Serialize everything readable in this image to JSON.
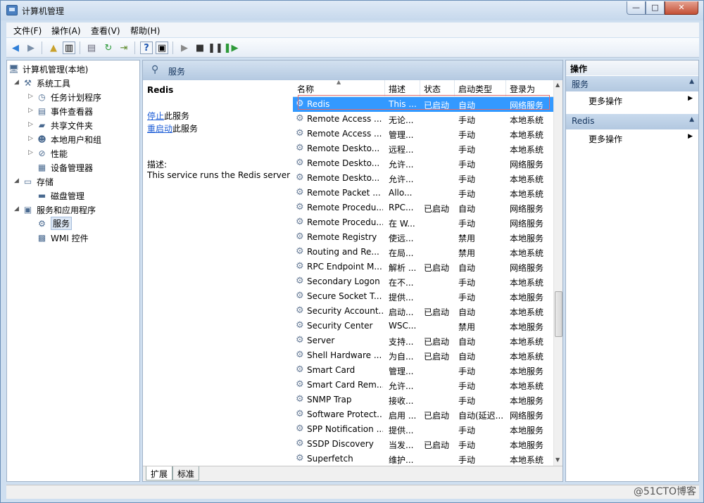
{
  "window": {
    "title": "计算机管理",
    "min": "—",
    "max": "□",
    "close": "✕"
  },
  "menubar": [
    {
      "label": "文件(F)"
    },
    {
      "label": "操作(A)"
    },
    {
      "label": "查看(V)"
    },
    {
      "label": "帮助(H)"
    }
  ],
  "tree": [
    {
      "label": "计算机管理(本地)",
      "icon": "computer-icon",
      "glyph": "🖥",
      "expand": "",
      "indent": 0
    },
    {
      "label": "系统工具",
      "icon": "tools-icon",
      "glyph": "⚒",
      "expand": "◢",
      "indent": 1
    },
    {
      "label": "任务计划程序",
      "icon": "clock-icon",
      "glyph": "◷",
      "expand": "▷",
      "indent": 2
    },
    {
      "label": "事件查看器",
      "icon": "event-viewer-icon",
      "glyph": "▤",
      "expand": "▷",
      "indent": 2
    },
    {
      "label": "共享文件夹",
      "icon": "shared-folder-icon",
      "glyph": "▰",
      "expand": "▷",
      "indent": 2
    },
    {
      "label": "本地用户和组",
      "icon": "users-icon",
      "glyph": "☻",
      "expand": "▷",
      "indent": 2
    },
    {
      "label": "性能",
      "icon": "performance-icon",
      "glyph": "⊘",
      "expand": "▷",
      "indent": 2
    },
    {
      "label": "设备管理器",
      "icon": "device-manager-icon",
      "glyph": "▦",
      "expand": "",
      "indent": 2
    },
    {
      "label": "存储",
      "icon": "storage-icon",
      "glyph": "▭",
      "expand": "◢",
      "indent": 1
    },
    {
      "label": "磁盘管理",
      "icon": "disk-icon",
      "glyph": "▬",
      "expand": "",
      "indent": 2
    },
    {
      "label": "服务和应用程序",
      "icon": "services-apps-icon",
      "glyph": "▣",
      "expand": "◢",
      "indent": 1
    },
    {
      "label": "服务",
      "icon": "gear-icon",
      "glyph": "⚙",
      "expand": "",
      "indent": 2,
      "selected": true
    },
    {
      "label": "WMI 控件",
      "icon": "wmi-icon",
      "glyph": "▩",
      "expand": "",
      "indent": 2
    }
  ],
  "center": {
    "title": "服务",
    "description": {
      "service_name": "Redis",
      "stop_link": "停止",
      "stop_suffix": "此服务",
      "restart_link": "重启动",
      "restart_suffix": "此服务",
      "desc_label": "描述:",
      "desc_text": "This service runs the Redis server"
    },
    "columns": [
      "名称",
      "描述",
      "状态",
      "启动类型",
      "登录为"
    ],
    "services": [
      {
        "name": "Redis",
        "desc": "This ...",
        "status": "已启动",
        "startup": "自动",
        "logon": "网络服务"
      },
      {
        "name": "Remote Access ...",
        "desc": "无论...",
        "status": "",
        "startup": "手动",
        "logon": "本地系统"
      },
      {
        "name": "Remote Access ...",
        "desc": "管理...",
        "status": "",
        "startup": "手动",
        "logon": "本地系统"
      },
      {
        "name": "Remote Deskto...",
        "desc": "远程...",
        "status": "",
        "startup": "手动",
        "logon": "本地系统"
      },
      {
        "name": "Remote Deskto...",
        "desc": "允许...",
        "status": "",
        "startup": "手动",
        "logon": "网络服务"
      },
      {
        "name": "Remote Deskto...",
        "desc": "允许...",
        "status": "",
        "startup": "手动",
        "logon": "本地系统"
      },
      {
        "name": "Remote Packet ...",
        "desc": "Allo...",
        "status": "",
        "startup": "手动",
        "logon": "本地系统"
      },
      {
        "name": "Remote Procedu...",
        "desc": "RPC...",
        "status": "已启动",
        "startup": "自动",
        "logon": "网络服务"
      },
      {
        "name": "Remote Procedu...",
        "desc": "在 W...",
        "status": "",
        "startup": "手动",
        "logon": "网络服务"
      },
      {
        "name": "Remote Registry",
        "desc": "使远...",
        "status": "",
        "startup": "禁用",
        "logon": "本地服务"
      },
      {
        "name": "Routing and Re...",
        "desc": "在局...",
        "status": "",
        "startup": "禁用",
        "logon": "本地系统"
      },
      {
        "name": "RPC Endpoint M...",
        "desc": "解析 ...",
        "status": "已启动",
        "startup": "自动",
        "logon": "网络服务"
      },
      {
        "name": "Secondary Logon",
        "desc": "在不...",
        "status": "",
        "startup": "手动",
        "logon": "本地系统"
      },
      {
        "name": "Secure Socket T...",
        "desc": "提供...",
        "status": "",
        "startup": "手动",
        "logon": "本地服务"
      },
      {
        "name": "Security Account...",
        "desc": "启动...",
        "status": "已启动",
        "startup": "自动",
        "logon": "本地系统"
      },
      {
        "name": "Security Center",
        "desc": "WSC...",
        "status": "",
        "startup": "禁用",
        "logon": "本地服务"
      },
      {
        "name": "Server",
        "desc": "支持...",
        "status": "已启动",
        "startup": "自动",
        "logon": "本地系统"
      },
      {
        "name": "Shell Hardware ...",
        "desc": "为自...",
        "status": "已启动",
        "startup": "自动",
        "logon": "本地系统"
      },
      {
        "name": "Smart Card",
        "desc": "管理...",
        "status": "",
        "startup": "手动",
        "logon": "本地服务"
      },
      {
        "name": "Smart Card Rem...",
        "desc": "允许...",
        "status": "",
        "startup": "手动",
        "logon": "本地系统"
      },
      {
        "name": "SNMP Trap",
        "desc": "接收...",
        "status": "",
        "startup": "手动",
        "logon": "本地服务"
      },
      {
        "name": "Software Protect...",
        "desc": "启用 ...",
        "status": "已启动",
        "startup": "自动(延迟...",
        "logon": "网络服务"
      },
      {
        "name": "SPP Notification ...",
        "desc": "提供...",
        "status": "",
        "startup": "手动",
        "logon": "本地服务"
      },
      {
        "name": "SSDP Discovery",
        "desc": "当发...",
        "status": "已启动",
        "startup": "手动",
        "logon": "本地服务"
      },
      {
        "name": "Superfetch",
        "desc": "维护...",
        "status": "",
        "startup": "手动",
        "logon": "本地系统"
      }
    ],
    "tabs": [
      "扩展",
      "标准"
    ]
  },
  "actions": {
    "header": "操作",
    "sections": [
      {
        "title": "服务",
        "item": "更多操作"
      },
      {
        "title": "Redis",
        "item": "更多操作"
      }
    ]
  },
  "watermark": "@51CTO博客"
}
